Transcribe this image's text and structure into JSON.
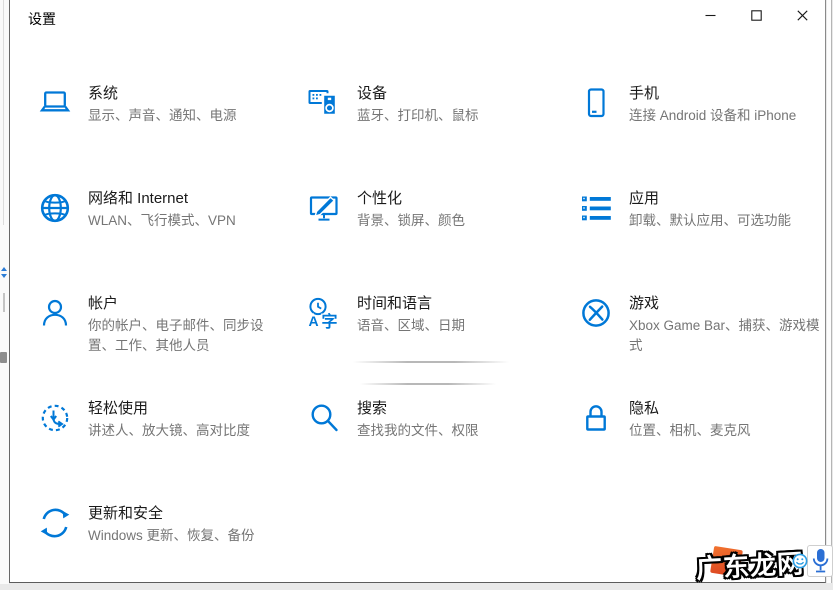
{
  "window": {
    "title": "设置"
  },
  "titlebar": {
    "buttons": [
      {
        "name": "minimize-icon"
      },
      {
        "name": "maximize-icon"
      },
      {
        "name": "close-icon"
      }
    ]
  },
  "tiles": [
    {
      "icon": "laptop-icon",
      "title": "系统",
      "subtitle": "显示、声音、通知、电源"
    },
    {
      "icon": "devices-icon",
      "title": "设备",
      "subtitle": "蓝牙、打印机、鼠标"
    },
    {
      "icon": "phone-icon",
      "title": "手机",
      "subtitle": "连接 Android 设备和 iPhone"
    },
    {
      "icon": "globe-icon",
      "title": "网络和 Internet",
      "subtitle": "WLAN、飞行模式、VPN"
    },
    {
      "icon": "personalization-icon",
      "title": "个性化",
      "subtitle": "背景、锁屏、颜色"
    },
    {
      "icon": "apps-list-icon",
      "title": "应用",
      "subtitle": "卸载、默认应用、可选功能"
    },
    {
      "icon": "account-icon",
      "title": "帐户",
      "subtitle": "你的帐户、电子邮件、同步设置、工作、其他人员"
    },
    {
      "icon": "time-language-icon",
      "title": "时间和语言",
      "subtitle": "语音、区域、日期"
    },
    {
      "icon": "xbox-icon",
      "title": "游戏",
      "subtitle": "Xbox Game Bar、捕获、游戏模式"
    },
    {
      "icon": "ease-of-access-icon",
      "title": "轻松使用",
      "subtitle": "讲述人、放大镜、高对比度"
    },
    {
      "icon": "search-icon",
      "title": "搜索",
      "subtitle": "查找我的文件、权限"
    },
    {
      "icon": "privacy-lock-icon",
      "title": "隐私",
      "subtitle": "位置、相机、麦克风"
    },
    {
      "icon": "sync-arrows-icon",
      "title": "更新和安全",
      "subtitle": "Windows 更新、恢复、备份"
    }
  ],
  "watermark": {
    "text": "广东龙网"
  },
  "colors": {
    "accent": "#0078d7",
    "title_text": "#1a1a1a",
    "subtitle_text": "#757575",
    "watermark_orange": "#e8542e",
    "watermark_blue": "#2a9ce2"
  }
}
